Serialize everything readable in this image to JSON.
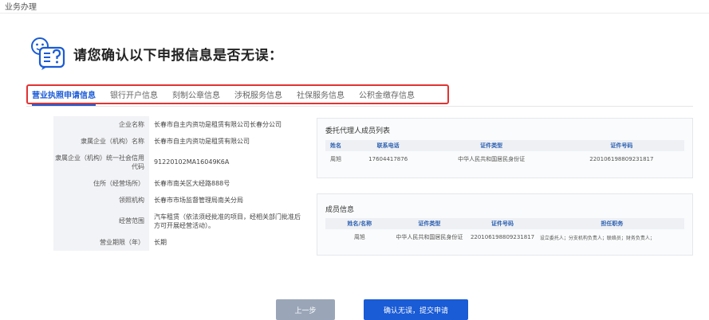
{
  "page": {
    "breadcrumb": "业务办理"
  },
  "heading": {
    "title": "请您确认以下申报信息是否无误："
  },
  "tabs": [
    {
      "label": "营业执照申请信息",
      "active": true
    },
    {
      "label": "银行开户信息",
      "active": false
    },
    {
      "label": "刻制公章信息",
      "active": false
    },
    {
      "label": "涉税服务信息",
      "active": false
    },
    {
      "label": "社保服务信息",
      "active": false
    },
    {
      "label": "公积金缴存信息",
      "active": false
    }
  ],
  "info": [
    {
      "label": "企业名称",
      "value": "长春市自主内资功是租赁有限公司长春分公司"
    },
    {
      "label": "隶属企业（机构）名称",
      "value": "长春市自主内资功是租赁有限公司"
    },
    {
      "label": "隶属企业（机构）统一社会信用代码",
      "value": "91220102MA16049K6A"
    },
    {
      "label": "住所（经营场所）",
      "value": "长春市南关区大经路888号"
    },
    {
      "label": "领照机构",
      "value": "长春市市场监督管理局南关分局"
    },
    {
      "label": "经营范围",
      "value": "汽车租赁（依法须经批准的项目，经相关部门批准后方可开展经营活动）。"
    },
    {
      "label": "营业期限（年）",
      "value": "长期"
    }
  ],
  "agents": {
    "title": "委托代理人成员列表",
    "headers": [
      "姓名",
      "联系电话",
      "证件类型",
      "证件号码"
    ],
    "rows": [
      [
        "周旭",
        "17604417876",
        "中华人民共和国居民身份证",
        "220106198809231817"
      ]
    ]
  },
  "members": {
    "title": "成员信息",
    "headers": [
      "姓名/名称",
      "证件类型",
      "证件号码",
      "担任职务"
    ],
    "rows": [
      [
        "周旭",
        "中华人民共和国居民身份证",
        "220106198809231817",
        "设立委托人；分支机构负责人；联络员；财务负责人；"
      ]
    ]
  },
  "buttons": {
    "prev": "上一步",
    "submit": "确认无误，提交申请"
  },
  "colors": {
    "accent": "#1a5bd6",
    "highlight_box": "#e23232",
    "prev_button": "#9aa6b8"
  }
}
